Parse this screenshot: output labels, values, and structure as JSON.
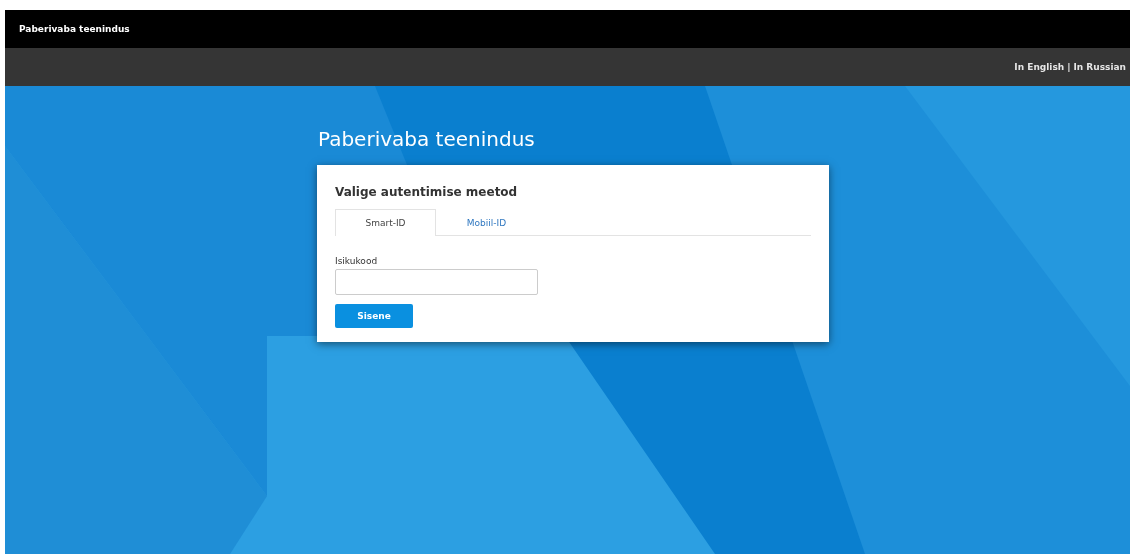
{
  "header": {
    "title": "Paberivaba teenindus"
  },
  "language_links": {
    "links": [
      "In English",
      "In Russian"
    ],
    "separator": "|"
  },
  "page_title": "Paberivaba teenindus",
  "card": {
    "heading": "Valige autentimise meetod",
    "tabs": [
      {
        "label": "Smart-ID",
        "selected": true
      },
      {
        "label": "Mobiil-ID",
        "selected": false
      }
    ],
    "field": {
      "label": "Isikukood"
    },
    "button": "Sisene"
  }
}
